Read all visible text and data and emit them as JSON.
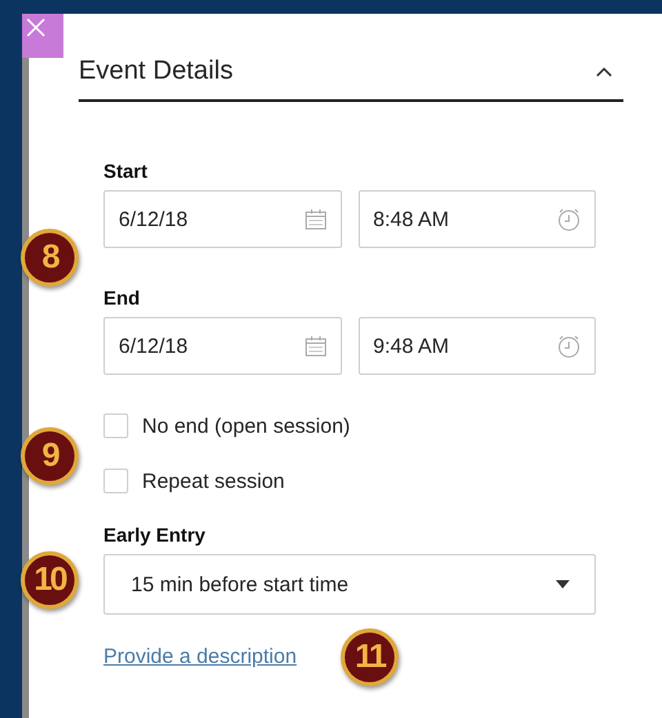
{
  "panel": {
    "title": "Event Details",
    "expanded": true
  },
  "start": {
    "label": "Start",
    "date": "6/12/18",
    "time": "8:48 AM"
  },
  "end": {
    "label": "End",
    "date": "6/12/18",
    "time": "9:48 AM",
    "callout": "8"
  },
  "options": {
    "callout": "9",
    "items": [
      {
        "label": "No end (open session)",
        "checked": false
      },
      {
        "label": "Repeat session",
        "checked": false
      }
    ]
  },
  "early_entry": {
    "label": "Early Entry",
    "value": "15 min before start time",
    "callout": "10"
  },
  "description_link": {
    "text": "Provide a description",
    "callout": "11"
  }
}
